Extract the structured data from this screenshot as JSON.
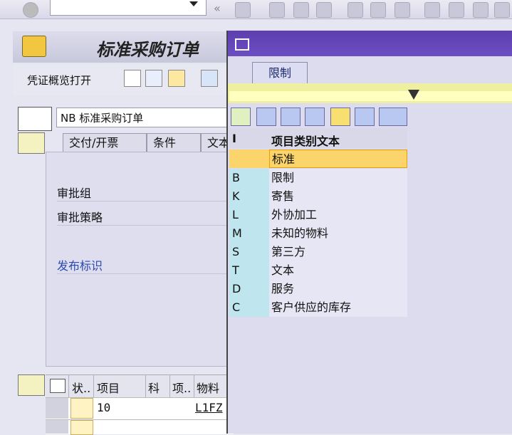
{
  "screen": {
    "title": "标准采购订单",
    "app_toolbar": {
      "overview_button": "凭证概览打开"
    },
    "doc_type": "NB 标准采购订单",
    "tabs": [
      "交付/开票",
      "条件",
      "文本"
    ],
    "fields": [
      "审批组",
      "审批策略",
      "发布标识"
    ],
    "item_table": {
      "headers": [
        "状..",
        "项目",
        "科",
        "项..",
        "物料"
      ],
      "rows": [
        {
          "item": "10",
          "material": "L1FZ"
        }
      ]
    }
  },
  "popup": {
    "tab": "限制",
    "columns": [
      "I",
      "项目类别文本"
    ],
    "rows": [
      {
        "code": "",
        "text": "标准",
        "selected": true
      },
      {
        "code": "B",
        "text": "限制"
      },
      {
        "code": "K",
        "text": "寄售"
      },
      {
        "code": "L",
        "text": "外协加工"
      },
      {
        "code": "M",
        "text": "未知的物料"
      },
      {
        "code": "S",
        "text": "第三方"
      },
      {
        "code": "T",
        "text": "文本"
      },
      {
        "code": "D",
        "text": "服务"
      },
      {
        "code": "C",
        "text": "客户供应的库存"
      }
    ]
  },
  "icons": {
    "toolbar": [
      "check-icon",
      "save-icon",
      "back-icon",
      "exit-icon",
      "cancel-icon",
      "print-icon",
      "find-icon",
      "find-next-icon",
      "first-page-icon",
      "prev-page-icon",
      "next-page-icon",
      "last-page-icon"
    ],
    "popup_toolbar": [
      "check-icon",
      "cancel-icon",
      "find-icon",
      "find-next-icon",
      "favorite-add-icon",
      "help-icon",
      "print-icon"
    ]
  }
}
